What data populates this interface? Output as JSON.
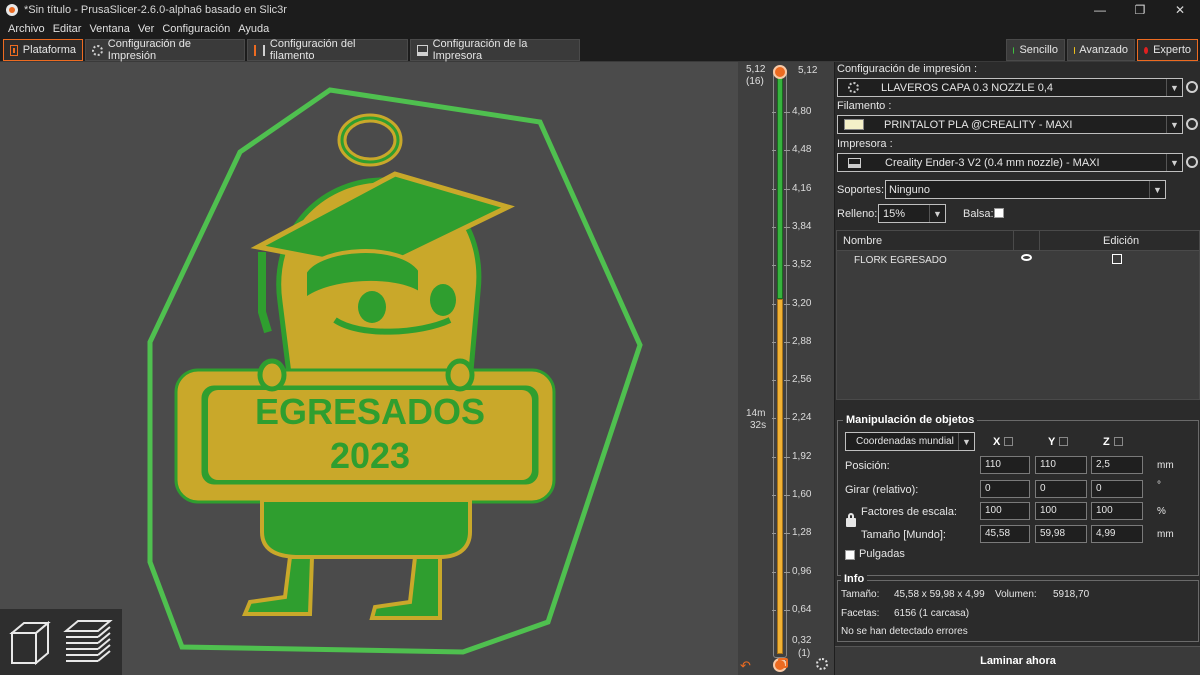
{
  "window": {
    "title": "*Sin título - PrusaSlicer-2.6.0-alpha6 basado en Slic3r",
    "controls": [
      "—",
      "❐",
      "✕"
    ]
  },
  "menu": [
    "Archivo",
    "Editar",
    "Ventana",
    "Ver",
    "Configuración",
    "Ayuda"
  ],
  "tabs": [
    {
      "label": "Plataforma",
      "icon": "plater-icon"
    },
    {
      "label": "Configuración de Impresión",
      "icon": "print-settings-icon"
    },
    {
      "label": "Configuración del filamento",
      "icon": "filament-icon"
    },
    {
      "label": "Configuración de la Impresora",
      "icon": "printer-icon"
    }
  ],
  "modes": [
    {
      "label": "Sencillo",
      "color": "#3fc43f"
    },
    {
      "label": "Avanzado",
      "color": "#f2c21b"
    },
    {
      "label": "Experto",
      "color": "#e02020"
    }
  ],
  "model": {
    "line1": "EGRESADOS",
    "line2": "2023",
    "colors": {
      "green": "#2f9e2f",
      "yellow": "#c9a82a",
      "skirt": "#4fc04f",
      "background": "#4b4b4b"
    }
  },
  "layer_slider": {
    "top_value": "5,12",
    "top_layer": "(16)",
    "ticks": [
      "4,80",
      "4,48",
      "4,16",
      "3,84",
      "3,52",
      "3,20",
      "2,88",
      "2,56",
      "2,24",
      "1,92",
      "1,60",
      "1,28",
      "0,96",
      "0,64"
    ],
    "bottom_value": "0,32",
    "bottom_layer": "(1)",
    "time_minutes": "14m",
    "time_seconds": "32s",
    "top_marker": "5,12",
    "green_fraction": 0.39
  },
  "panel": {
    "print_label": "Configuración de impresión :",
    "print_value": "LLAVEROS CAPA 0.3 NOZZLE 0,4",
    "filament_label": "Filamento :",
    "filament_value": "PRINTALOT PLA @CREALITY - MAXI",
    "printer_label": "Impresora :",
    "printer_value": "Creality Ender-3 V2 (0.4 mm nozzle) - MAXI",
    "supports_label": "Soportes:",
    "supports_value": "Ninguno",
    "infill_label": "Relleno:",
    "infill_value": "15%",
    "brim_label": "Balsa:",
    "object_list": {
      "col_name": "Nombre",
      "col_edit": "Edición",
      "rows": [
        "FLORK EGRESADO"
      ]
    },
    "manipulation": {
      "title": "Manipulación de objetos",
      "coord_system": "Coordenadas mundial",
      "axes": [
        "X",
        "Y",
        "Z"
      ],
      "position_label": "Posición:",
      "position": [
        "110",
        "110",
        "2,5"
      ],
      "position_unit": "mm",
      "rotation_label": "Girar (relativo):",
      "rotation": [
        "0",
        "0",
        "0"
      ],
      "rotation_unit": "°",
      "scale_label": "Factores de escala:",
      "scale": [
        "100",
        "100",
        "100"
      ],
      "scale_unit": "%",
      "size_label": "Tamaño [Mundo]:",
      "size": [
        "45,58",
        "59,98",
        "4,99"
      ],
      "size_unit": "mm",
      "inches_label": "Pulgadas"
    },
    "info": {
      "title": "Info",
      "size_label": "Tamaño:",
      "size_value": "45,58 x 59,98 x 4,99",
      "volume_label": "Volumen:",
      "volume_value": "5918,70",
      "facets_label": "Facetas:",
      "facets_value": "6156 (1 carcasa)",
      "errors": "No se han detectado errores"
    },
    "slice_button": "Laminar ahora"
  }
}
